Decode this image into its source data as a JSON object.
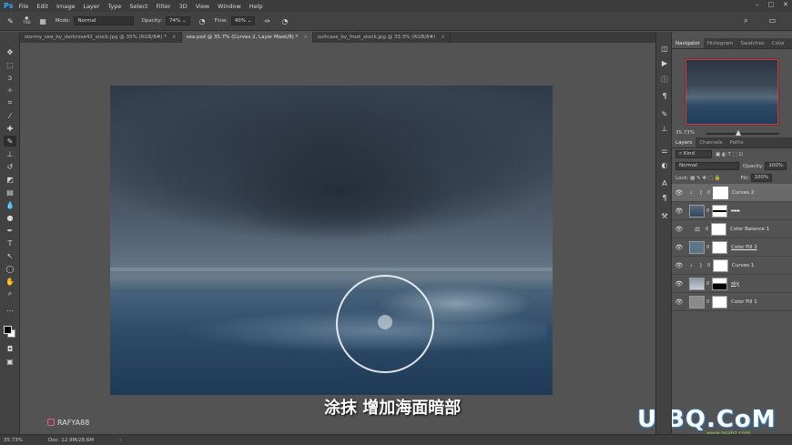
{
  "app": {
    "logo": "Ps"
  },
  "menu": [
    "File",
    "Edit",
    "Image",
    "Layer",
    "Type",
    "Select",
    "Filter",
    "3D",
    "View",
    "Window",
    "Help"
  ],
  "options_bar": {
    "brush_size": "700",
    "mode_label": "Mode:",
    "mode_value": "Normal",
    "opacity_label": "Opacity:",
    "opacity_value": "74%",
    "flow_label": "Flow:",
    "flow_value": "40%"
  },
  "doc_tabs": [
    {
      "label": "stormy_sea_by_darkrose42_stock.jpg @ 35% (RGB/8#) *"
    },
    {
      "label": "sea.psd @ 35.7% (Curves 2, Layer Mask/8) *"
    },
    {
      "label": "suitcase_by_frozt_stock.jpg @ 33.3% (RGB/8#)"
    }
  ],
  "navigator": {
    "tabs": [
      "Navigator",
      "Histogram",
      "Swatches",
      "Color"
    ],
    "zoom": "35.73%"
  },
  "layers_panel": {
    "tabs": [
      "Layers",
      "Channels",
      "Paths"
    ],
    "kind_label": "Kind",
    "blend_mode": "Normal",
    "opacity_label": "Opacity:",
    "opacity_value": "100%",
    "lock_label": "Lock:",
    "fill_label": "Fill:",
    "fill_value": "100%",
    "layers": [
      {
        "name": "Curves 2",
        "type": "curves",
        "selected": true
      },
      {
        "name": "sea",
        "type": "image"
      },
      {
        "name": "Color Balance 1",
        "type": "balance"
      },
      {
        "name": "Color Fill 2",
        "type": "fill"
      },
      {
        "name": "Curves 1",
        "type": "curves"
      },
      {
        "name": "sky",
        "type": "image"
      },
      {
        "name": "Color Fill 1",
        "type": "fill"
      }
    ]
  },
  "status": {
    "zoom": "35.73%",
    "doc": "Doc: 12.9M/28.6M"
  },
  "subtitle": "涂抹  增加海面暗部",
  "watermark_left": "RAFYA88",
  "watermark_right": "UiBQ.CoM",
  "watermark_right_small": "www.psahz.com"
}
